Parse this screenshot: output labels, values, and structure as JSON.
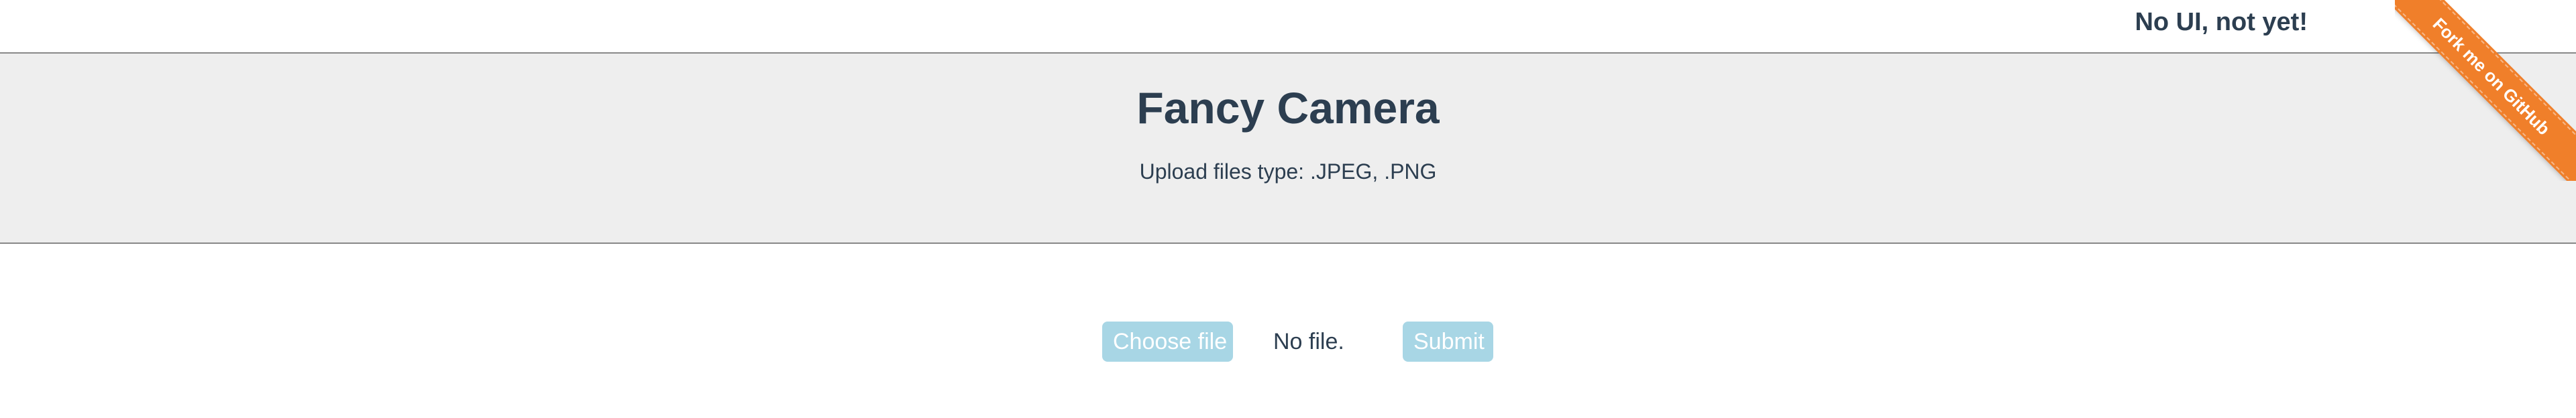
{
  "topbar": {
    "tagline": "No UI, not yet!"
  },
  "hero": {
    "title": "Fancy Camera",
    "subtitle": "Upload files type: .JPEG, .PNG"
  },
  "form": {
    "choose_file_label": "Choose file",
    "file_status": "No file.",
    "submit_label": "Submit"
  },
  "ribbon": {
    "label": "Fork me on GitHub",
    "color": "#f07f2a"
  },
  "colors": {
    "button_bg": "#a8d6e5",
    "hero_bg": "#eeeeee",
    "text": "#2c3e50"
  }
}
